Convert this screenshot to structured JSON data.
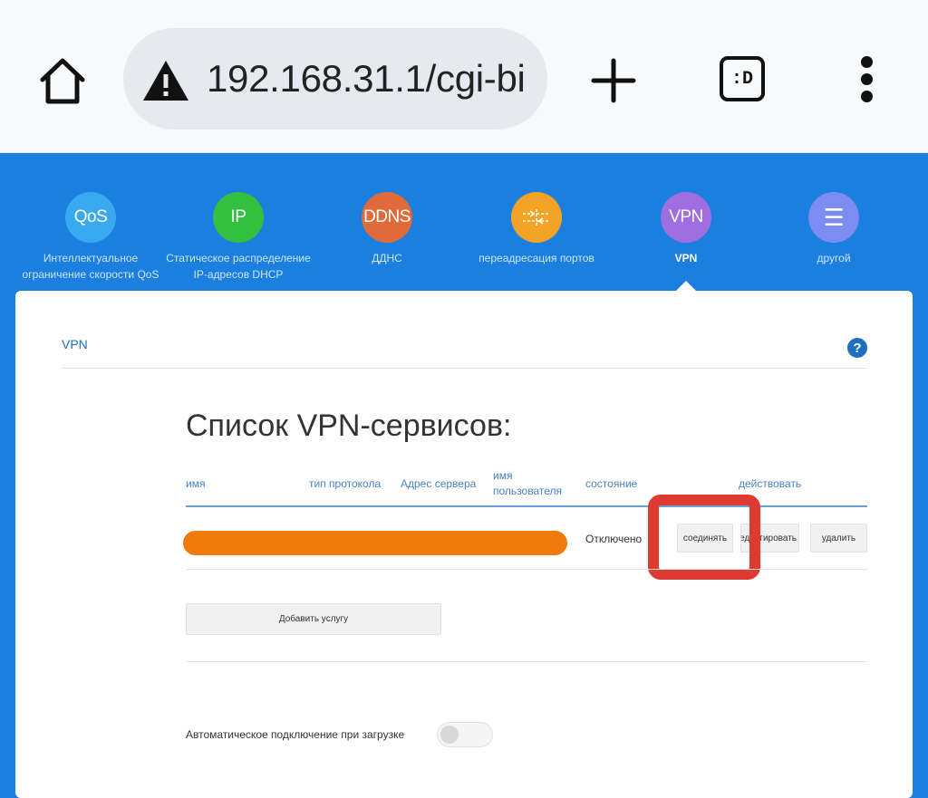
{
  "browser": {
    "url": "192.168.31.1/cgi-bi",
    "tabs_label": ":D"
  },
  "nav": {
    "items": [
      {
        "icon_text": "QoS",
        "label": "Интеллектуальное ограничение скорости QoS",
        "color": "#3aaaf0"
      },
      {
        "icon_text": "IP",
        "label": "Статическое распределение IP-адресов DHCP",
        "color": "#33c040"
      },
      {
        "icon_text": "DDNS",
        "label": "ДДНС",
        "color": "#e06a3a"
      },
      {
        "icon_text": "",
        "label": "переадресация портов",
        "color": "#f5a325"
      },
      {
        "icon_text": "VPN",
        "label": "VPN",
        "color": "#a06ee0"
      },
      {
        "icon_text": "☰",
        "label": "другой",
        "color": "#7b8cf3"
      }
    ]
  },
  "card": {
    "title": "VPN",
    "help": "?",
    "heading": "Список VPN-сервисов:",
    "columns": {
      "name": "имя",
      "protocol": "тип протокола",
      "server": "Адрес сервера",
      "username": "имя пользователя",
      "status": "состояние",
      "action": "действовать"
    },
    "row": {
      "status": "Отключено",
      "connect": "соединять",
      "edit": "редактировать",
      "delete": "удалить"
    },
    "add_button": "Добавить услугу",
    "auto_connect_label": "Автоматическое подключение при загрузке"
  },
  "colors": {
    "header_blue": "#1a7fdf",
    "accent_link": "#1e6fc0",
    "redaction": "#f07a0b",
    "highlight": "#df3a2f"
  }
}
